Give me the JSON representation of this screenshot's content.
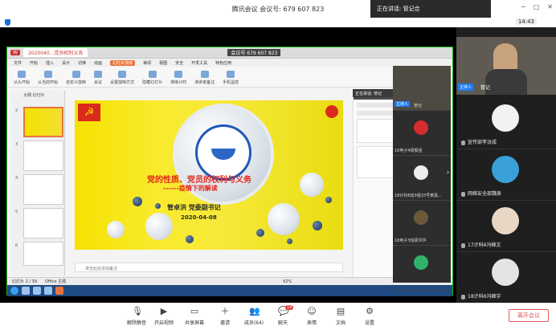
{
  "window": {
    "title": "腾讯会议 会议号: 679 607 823",
    "time": "14:43"
  },
  "speaking": {
    "label": "正在讲话: 管记合",
    "overlay": "正在讲话: 管记"
  },
  "wps": {
    "tab": "2020040...党员权利义务",
    "meeting_id_tab": "会议号 679 607 823",
    "menu": [
      "文件",
      "开始",
      "插入",
      "设计",
      "切换",
      "动画",
      "幻灯片放映",
      "审阅",
      "视图",
      "安全",
      "开发工具",
      "特色应用"
    ],
    "active_menu": "幻灯片放映",
    "ribbon": [
      "从头开始",
      "从当前开始",
      "自定义放映",
      "会议",
      "设置放映方式",
      "隐藏幻灯片",
      "排练计时",
      "演讲者备注",
      "手机遥控"
    ],
    "left_tabs": "大纲 幻灯片",
    "status": [
      "幻灯片 2 / 39",
      "Office 主题"
    ],
    "zoom": "62%",
    "notes_placeholder": "单击此处添加备注",
    "props_head": "自定义动画"
  },
  "slide": {
    "title": "党的性质、党员的权利与义务",
    "subtitle": "------疫情下的解读",
    "author": "管卓洪 党委副书记",
    "date": "2020-04-08"
  },
  "strip": {
    "host_badge": "主持人",
    "items": [
      {
        "name": "管记"
      },
      {
        "name": "18电子4梁振强"
      },
      {
        "name": "18计科6班3组33号黄嘉..."
      },
      {
        "name": "18电子3班梁洪洪"
      }
    ]
  },
  "right_panel": {
    "host_badge": "主持人",
    "host_name": "管记",
    "tiles": [
      {
        "name": "宣传部李汶成"
      },
      {
        "name": "网络安全部魏泉"
      },
      {
        "name": "17计科6冯峰文"
      },
      {
        "name": "18计科6冯峰宇"
      }
    ]
  },
  "toolbar": [
    {
      "label": "解除静音",
      "icon": "mic-icon"
    },
    {
      "label": "开启视频",
      "icon": "camera-icon"
    },
    {
      "label": "共享屏幕",
      "icon": "screen-share-icon"
    },
    {
      "label": "邀请",
      "icon": "invite-icon"
    },
    {
      "label": "成员(64)",
      "icon": "members-icon"
    },
    {
      "label": "聊天",
      "icon": "chat-icon",
      "badge": "19"
    },
    {
      "label": "表情",
      "icon": "emoji-icon"
    },
    {
      "label": "文档",
      "icon": "document-icon"
    },
    {
      "label": "设置",
      "icon": "settings-icon"
    }
  ],
  "leave_label": "离开会议"
}
